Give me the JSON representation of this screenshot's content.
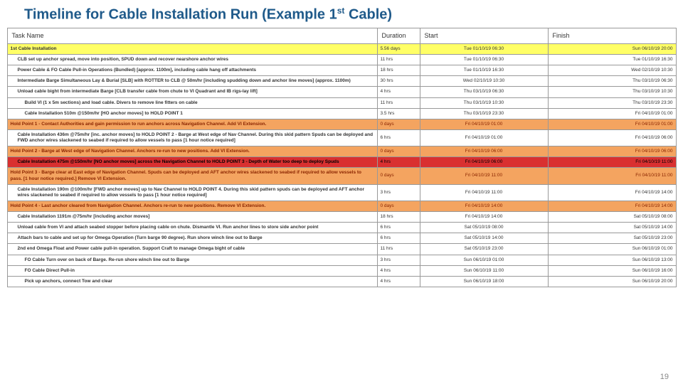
{
  "page_number": "19",
  "title_parts": {
    "pre": "Timeline for Cable Installation Run (Example 1",
    "sup": "st",
    "post": " Cable)"
  },
  "headers": {
    "name": "Task Name",
    "duration": "Duration",
    "start": "Start",
    "finish": "Finish"
  },
  "rows": [
    {
      "cls": "yellow sum",
      "indent": 0,
      "name": "1st Cable Installation",
      "duration": "5.56 days",
      "start": "Tue 01/10/19 06:30",
      "finish": "Sun 06/10/19 20:00"
    },
    {
      "cls": "plain",
      "indent": 1,
      "name": "CLB set up anchor spread, move into position, SPUD down and recover nearshore anchor wires",
      "duration": "11 hrs",
      "start": "Tue 01/10/19 06:30",
      "finish": "Tue 01/10/19 16:30"
    },
    {
      "cls": "plain",
      "indent": 1,
      "name": "Power Cable & FO Cable Pull-in Operations (Bundled) [approx. 1100m], including cable hang off attachments",
      "duration": "18 hrs",
      "start": "Tue 01/10/19 16:30",
      "finish": "Wed 02/10/19 10:30"
    },
    {
      "cls": "plain",
      "indent": 1,
      "name": "Intermediate Barge Simultaneous Lay & Burial [SLB] with ROTTER to CLB @ 50m/hr [including spudding down and anchor line moves] (approx. 1100m)",
      "duration": "30 hrs",
      "start": "Wed 02/10/19 10:30",
      "finish": "Thu 03/10/19 06:30"
    },
    {
      "cls": "plain",
      "indent": 1,
      "name": "Unload cable bight from intermediate Barge [CLB transfer cable from chute to VI Quadrant and IB rigs-lay lift]",
      "duration": "4 hrs",
      "start": "Thu 03/10/19 06:30",
      "finish": "Thu 03/10/19 10:30"
    },
    {
      "cls": "plain",
      "indent": 2,
      "name": "Build VI (1 x 5m sections) and load cable. Divers to remove line fitters on cable",
      "duration": "11 hrs",
      "start": "Thu 03/10/19 10:30",
      "finish": "Thu 03/10/19 23:30"
    },
    {
      "cls": "plain",
      "indent": 2,
      "name": "Cable Installation 510m @150m/hr [HO anchor moves] to HOLD POINT 1",
      "duration": "3.5 hrs",
      "start": "Thu 03/10/19 23:30",
      "finish": "Fri 04/10/19 01:00"
    },
    {
      "cls": "orange",
      "indent": 0,
      "name": "Hold Point 1 - Contact Authorities and gain permission to run anchors across Navigation Channel. Add VI Extension.",
      "duration": "0 days",
      "start": "Fri 04/10/19 01:00",
      "finish": "Fri 04/10/19 01:00"
    },
    {
      "cls": "plain",
      "indent": 1,
      "name": "Cable Installation 436m @75m/hr [inc. anchor moves] to HOLD POINT 2 - Barge at West edge of Nav Channel. During this skid pattern Spuds can be deployed and FWD anchor wires slackened to seabed if required to allow vessels to pass [1 hour notice required]",
      "duration": "6 hrs",
      "start": "Fri 04/10/19 01:00",
      "finish": "Fri 04/10/19 06:00"
    },
    {
      "cls": "orange",
      "indent": 0,
      "name": "Hold Point 2 - Barge at West edge of Navigation Channel. Anchors re-run to new positions. Add VI Extension.",
      "duration": "0 days",
      "start": "Fri 04/10/19 06:00",
      "finish": "Fri 04/10/19 06:00"
    },
    {
      "cls": "red",
      "indent": 1,
      "name": "Cable Installation 475m @150m/hr [NO anchor moves] across the Navigation Channel to HOLD POINT 3 - Depth of Water too deep to deploy Spuds",
      "duration": "4 hrs",
      "start": "Fri 04/10/19 06:00",
      "finish": "Fri 04/10/19 11:00"
    },
    {
      "cls": "orange",
      "indent": 0,
      "name": "Hold Point 3 - Barge clear at East edge of Navigation Channel. Spuds can be deployed and AFT anchor wires slackened to seabed if required to allow vessels to pass. [1 hour notice required.] Remove VI Extension.",
      "duration": "0 days",
      "start": "Fri 04/10/19 11:00",
      "finish": "Fri 04/10/19 11:00"
    },
    {
      "cls": "plain",
      "indent": 1,
      "name": "Cable Installation 190m @100m/hr [FWD anchor moves] up to Nav Channel to HOLD POINT 4. During this skid pattern spuds can be deployed and AFT anchor wires slackened to seabed if required to allow vessels to pass [1 hour notice required]",
      "duration": "3 hrs",
      "start": "Fri 04/10/19 11:00",
      "finish": "Fri 04/10/19 14:00"
    },
    {
      "cls": "orange",
      "indent": 0,
      "name": "Hold Point 4 - Last anchor cleared from Navigation Channel. Anchors re-run to new positions. Remove VI Extension.",
      "duration": "0 days",
      "start": "Fri 04/10/19 14:00",
      "finish": "Fri 04/10/19 14:00"
    },
    {
      "cls": "plain",
      "indent": 1,
      "name": "Cable Installation 1191m @75m/hr [including anchor moves]",
      "duration": "18 hrs",
      "start": "Fri 04/10/19 14:00",
      "finish": "Sat 05/10/19 08:00"
    },
    {
      "cls": "plain",
      "indent": 1,
      "name": "Unload cable from VI and attach seabed stopper before placing cable on chute. Dismantle VI. Run anchor lines to store side anchor point",
      "duration": "6 hrs",
      "start": "Sat 05/10/19 08:00",
      "finish": "Sat 05/10/19 14:00"
    },
    {
      "cls": "plain",
      "indent": 1,
      "name": "Attach bars to cable and set up for Omega Operation (Turn barge 90 degree). Run shore winch line out to Barge",
      "duration": "6 hrs",
      "start": "Sat 05/10/19 14:00",
      "finish": "Sat 05/10/19 23:00"
    },
    {
      "cls": "plain",
      "indent": 1,
      "name": "2nd end Omega Float and Power cable pull-in operation. Support Craft to manage Omega bight of cable",
      "duration": "11 hrs",
      "start": "Sat 05/10/19 23:00",
      "finish": "Sun 06/10/19 01:00"
    },
    {
      "cls": "plain",
      "indent": 2,
      "name": "FO Cable Turn over on back of Barge. Re-run shore winch line out to Barge",
      "duration": "3 hrs",
      "start": "Sun 06/10/19 01:00",
      "finish": "Sun 06/10/19 13:00"
    },
    {
      "cls": "plain",
      "indent": 2,
      "name": "FO Cable Direct Pull-in",
      "duration": "4 hrs",
      "start": "Sun 06/10/19 11:00",
      "finish": "Sun 06/10/19 16:00"
    },
    {
      "cls": "plain",
      "indent": 2,
      "name": "Pick up anchors, connect Tow and clear",
      "duration": "4 hrs",
      "start": "Sun 06/10/19 18:00",
      "finish": "Sun 06/10/19 20:00"
    }
  ]
}
